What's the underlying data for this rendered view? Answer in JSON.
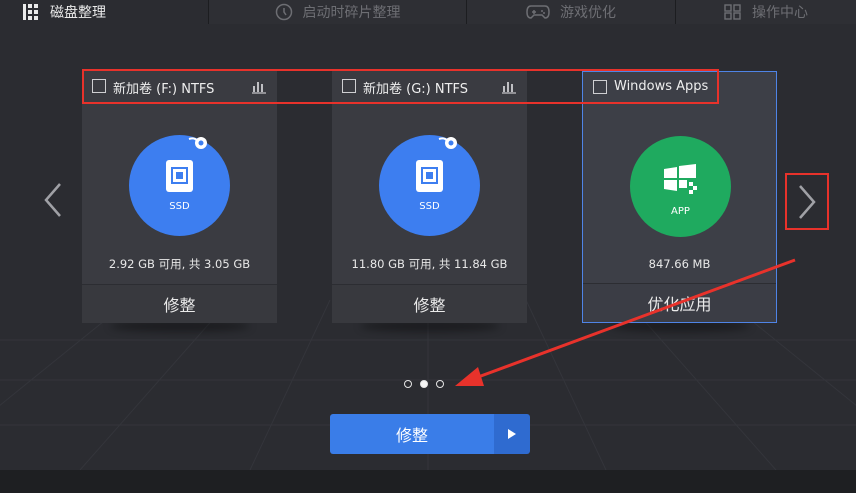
{
  "tabs": [
    {
      "label": "磁盘整理",
      "icon": "disk-grid-icon",
      "active": true
    },
    {
      "label": "启动时碎片整理",
      "icon": "startup-clock-icon",
      "active": false
    },
    {
      "label": "游戏优化",
      "icon": "gamepad-icon",
      "active": false
    },
    {
      "label": "操作中心",
      "icon": "grid-squares-icon",
      "active": false
    }
  ],
  "cards": [
    {
      "label": "新加卷 (F:) NTFS",
      "type_text": "SSD",
      "capacity": "2.92 GB 可用, 共 3.05 GB",
      "action": "修整",
      "icon": "ssd-icon"
    },
    {
      "label": "新加卷 (G:) NTFS",
      "type_text": "SSD",
      "capacity": "11.80 GB 可用, 共 11.84 GB",
      "action": "修整",
      "icon": "ssd-icon"
    },
    {
      "label": "Windows Apps",
      "type_text": "APP",
      "capacity": "847.66 MB",
      "action": "优化应用",
      "icon": "windows-app-icon"
    }
  ],
  "pager": {
    "count": 3,
    "active_index": 1
  },
  "main_button": {
    "label": "修整"
  },
  "colors": {
    "accent": "#3a7de8",
    "annotation": "#e8322b",
    "app_green": "#1faa5f"
  }
}
